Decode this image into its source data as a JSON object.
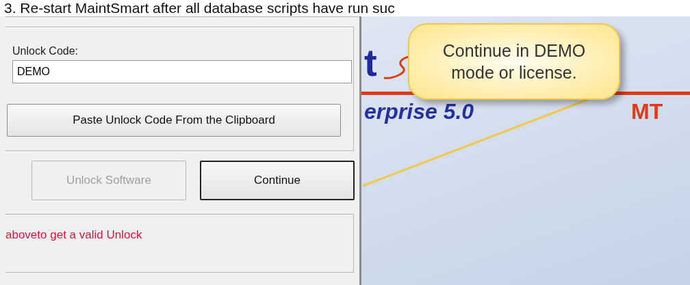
{
  "heading": "3. Re-start MaintSmart after all database scripts have run suc",
  "dialog": {
    "unlock_label": "Unlock Code:",
    "unlock_code": "DEMO",
    "paste_button": "Paste Unlock Code From the Clipboard",
    "buttons": [
      {
        "label": "Unlock Software",
        "disabled": true,
        "default": false
      },
      {
        "label": "Continue",
        "disabled": false,
        "default": true
      }
    ],
    "message": "aboveto get a valid Unlock"
  },
  "splash": {
    "logo_parts": [
      "t",
      "erprise 5.0",
      "MT"
    ]
  },
  "callout": {
    "text": "Continue in DEMO mode or license."
  }
}
